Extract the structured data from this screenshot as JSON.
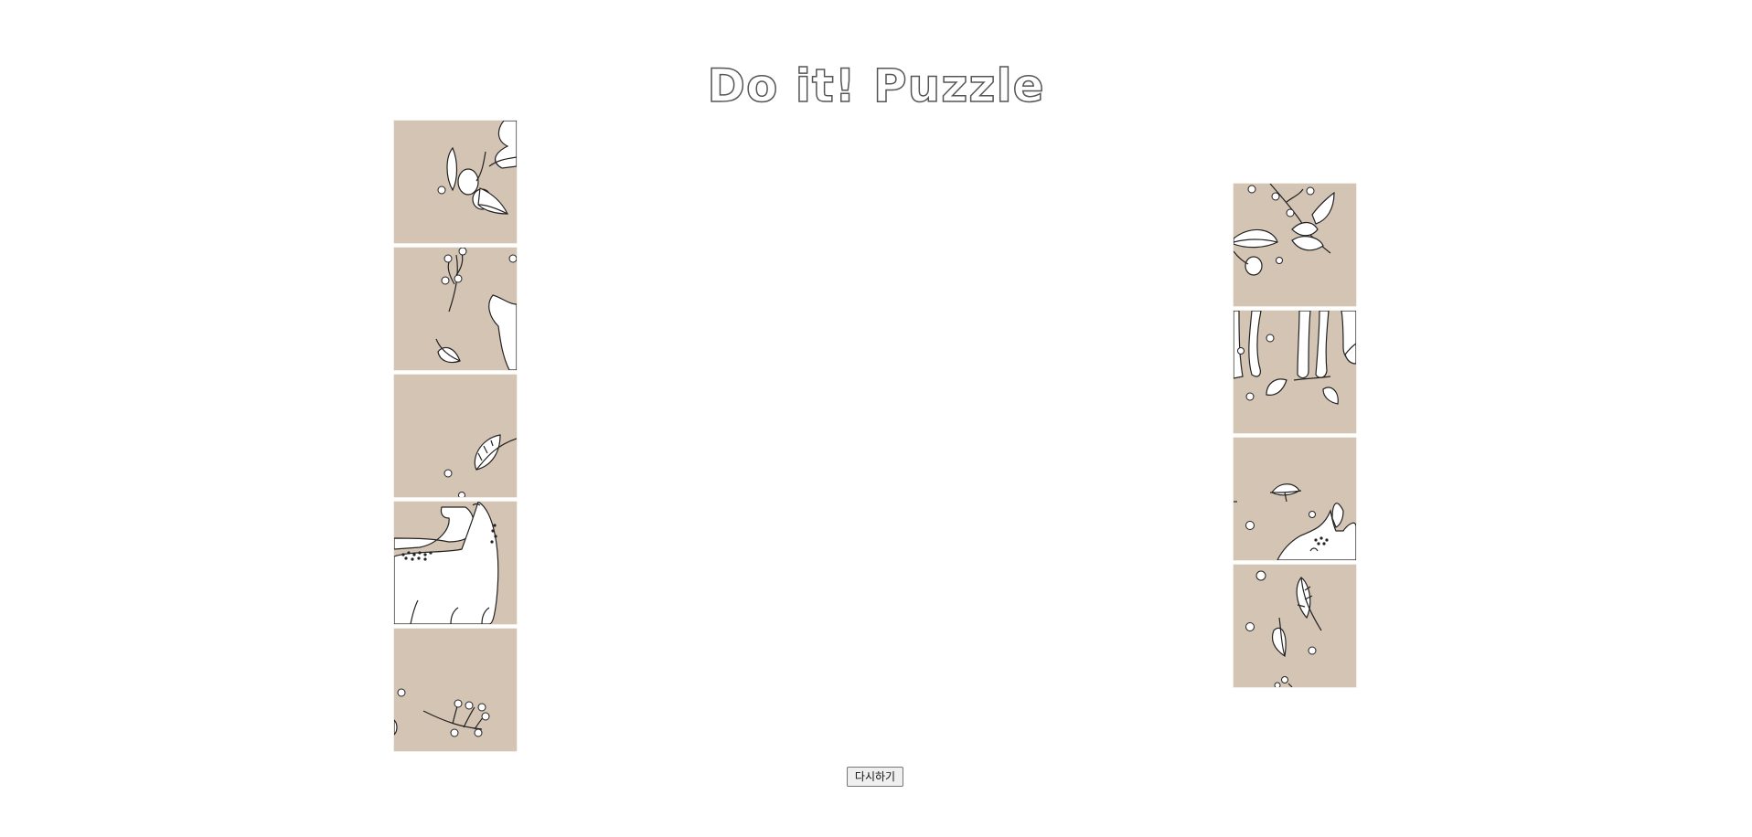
{
  "title": "Do it! Puzzle",
  "restart_button": "다시하기",
  "colors": {
    "tile_background": "#d4c4b4",
    "ink": "#222222",
    "fill": "#ffffff"
  },
  "left_pieces": [
    {
      "art": "acorns"
    },
    {
      "art": "sprig-and-ear"
    },
    {
      "art": "single-leaf"
    },
    {
      "art": "deer-body"
    },
    {
      "art": "berry-sprig"
    }
  ],
  "right_pieces": [
    {
      "art": "leafy-branch"
    },
    {
      "art": "deer-legs"
    },
    {
      "art": "deer-head"
    },
    {
      "art": "leaves-and-dots"
    }
  ]
}
